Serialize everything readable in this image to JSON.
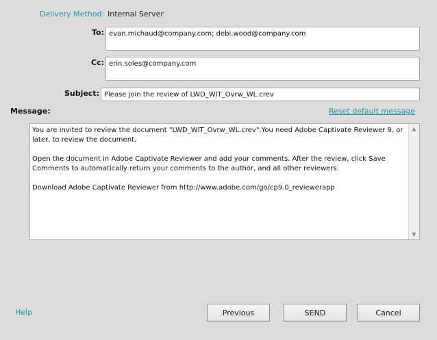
{
  "delivery": {
    "label": "Delivery Method:",
    "value": "Internal Server"
  },
  "to": {
    "label": "To:",
    "value": "evan.michaud@company.com; debi.wood@company.com"
  },
  "cc": {
    "label": "Cc:",
    "value": "erin.soles@company.com"
  },
  "subject": {
    "label": "Subject:",
    "value": "Please join the review of LWD_WIT_Ovrw_WL.crev"
  },
  "message": {
    "label": "Message:",
    "reset_link": "Reset default message",
    "paragraphs": [
      "You are invited to review the document \"LWD_WIT_Ovrw_WL.crev\".You need Adobe Captivate Reviewer 9, or later, to review the document.",
      "Open the document in Adobe Captivate Reviewer and add your comments. After the review, click Save Comments to automatically return your comments to the author, and all other reviewers.",
      "Download Adobe Captivate Reviewer from http://www.adobe.com/go/cp9.0_reviewerapp"
    ]
  },
  "footer": {
    "help": "Help",
    "previous": "Previous",
    "send": "SEND",
    "cancel": "Cancel"
  }
}
